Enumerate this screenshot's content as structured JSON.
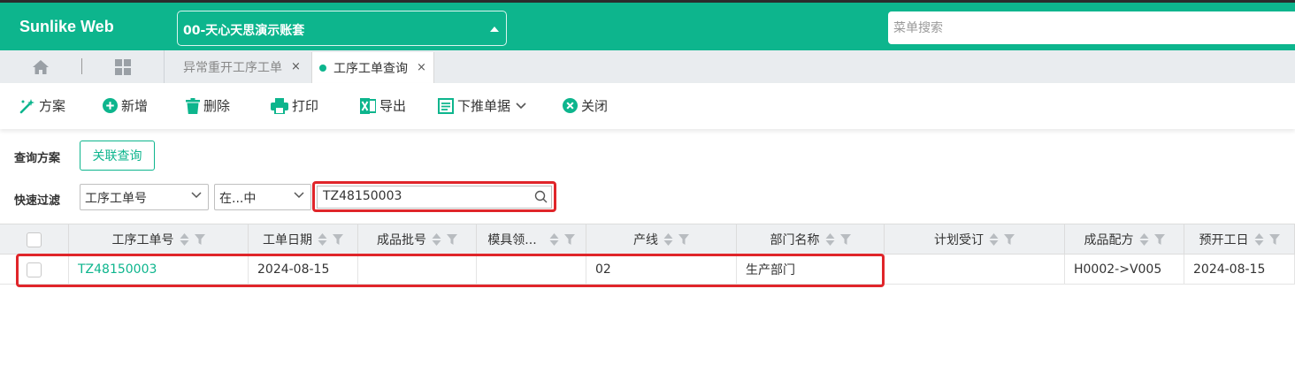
{
  "header": {
    "brand": "Sunlike Web",
    "account": "00-天心天思演示账套",
    "menu_search_placeholder": "菜单搜索"
  },
  "tabs": [
    {
      "label": "异常重开工序工单",
      "close": "×"
    },
    {
      "label": "工序工单查询",
      "close": "×",
      "active": true
    }
  ],
  "toolbar": {
    "scheme": "方案",
    "add": "新增",
    "delete": "删除",
    "print": "打印",
    "export": "导出",
    "push_down": "下推单据",
    "close": "关闭"
  },
  "filter": {
    "query_scheme_label": "查询方案",
    "assoc_query": "关联查询",
    "quick_filter_label": "快速过滤",
    "field_select": "工序工单号",
    "operator_select": "在...中",
    "search_value": "TZ48150003"
  },
  "grid": {
    "columns": [
      "工序工单号",
      "工单日期",
      "成品批号",
      "模具领...",
      "产线",
      "部门名称",
      "计划受订",
      "成品配方",
      "预开工日"
    ],
    "rows": [
      [
        "TZ48150003",
        "2024-08-15",
        "",
        "",
        "02",
        "生产部门",
        "",
        "H0002->V005",
        "2024-08-15"
      ]
    ]
  },
  "colors": {
    "accent": "#0db58d",
    "highlight": "#e0252a"
  }
}
